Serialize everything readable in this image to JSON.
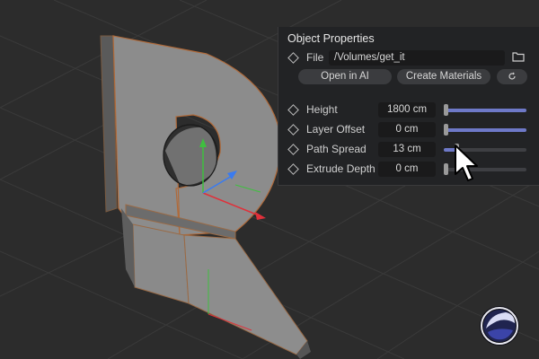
{
  "panel": {
    "title": "Object Properties",
    "file_label": "File",
    "file_path": "/Volumes/get_it",
    "buttons": {
      "open_in_ai": "Open in AI",
      "create_materials": "Create Materials"
    },
    "properties": [
      {
        "label": "Height",
        "value": "1800 cm",
        "slider_fraction": 1.0
      },
      {
        "label": "Layer Offset",
        "value": "0 cm",
        "slider_fraction": 1.0
      },
      {
        "label": "Path Spread",
        "value": "13 cm",
        "slider_fraction": 0.15
      },
      {
        "label": "Extrude Depth",
        "value": "0 cm",
        "slider_fraction": 0.0
      }
    ]
  },
  "icons": [
    "diamond-keyframe-icon",
    "folder-icon",
    "refresh-icon",
    "cinema4d-logo-icon",
    "mouse-cursor-icon"
  ],
  "colors": {
    "slider_fill": "#6e79c8",
    "panel_bg": "#222325",
    "viewport_bg": "#2c2c2c",
    "axis_x": "#e0303a",
    "axis_y": "#3fbf3f",
    "axis_z": "#3a7bf0"
  }
}
